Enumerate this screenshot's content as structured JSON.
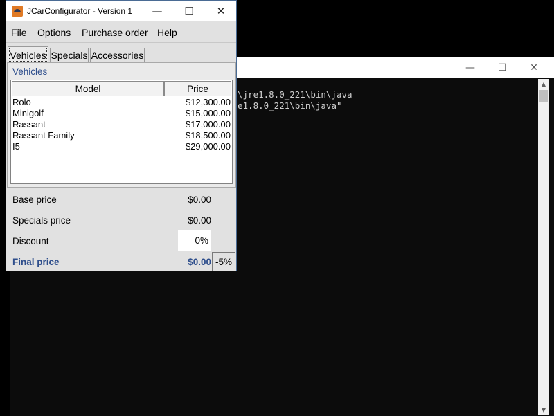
{
  "console": {
    "lines": [
      "\\jre1.8.0_221\\bin\\java",
      "e1.8.0_221\\bin\\java\""
    ],
    "controls": {
      "minimize": "—",
      "maximize": "☐",
      "close": "✕"
    }
  },
  "app": {
    "title": "JCarConfigurator - Version 1",
    "controls": {
      "minimize": "—",
      "maximize": "☐",
      "close": "✕"
    },
    "menu": [
      {
        "label": "File",
        "u": "F",
        "rest": "ile"
      },
      {
        "label": "Options",
        "u": "O",
        "rest": "ptions"
      },
      {
        "label": "Purchase order",
        "u": "P",
        "rest": "urchase order"
      },
      {
        "label": "Help",
        "u": "H",
        "rest": "elp"
      }
    ],
    "tabs": [
      "Vehicles",
      "Specials",
      "Accessories"
    ],
    "panel_title": "Vehicles",
    "table": {
      "headers": [
        "Model",
        "Price"
      ],
      "rows": [
        [
          "Rolo",
          "$12,300.00"
        ],
        [
          "Minigolf",
          "$15,000.00"
        ],
        [
          "Rassant",
          "$17,000.00"
        ],
        [
          "Rassant Family",
          "$18,500.00"
        ],
        [
          "I5",
          "$29,000.00"
        ]
      ]
    },
    "summary": {
      "base_label": "Base price",
      "base_value": "$0.00",
      "specials_label": "Specials price",
      "specials_value": "$0.00",
      "discount_label": "Discount",
      "discount_value": "0%",
      "final_label": "Final price",
      "final_value": "$0.00",
      "discount_button": "-5%"
    }
  }
}
